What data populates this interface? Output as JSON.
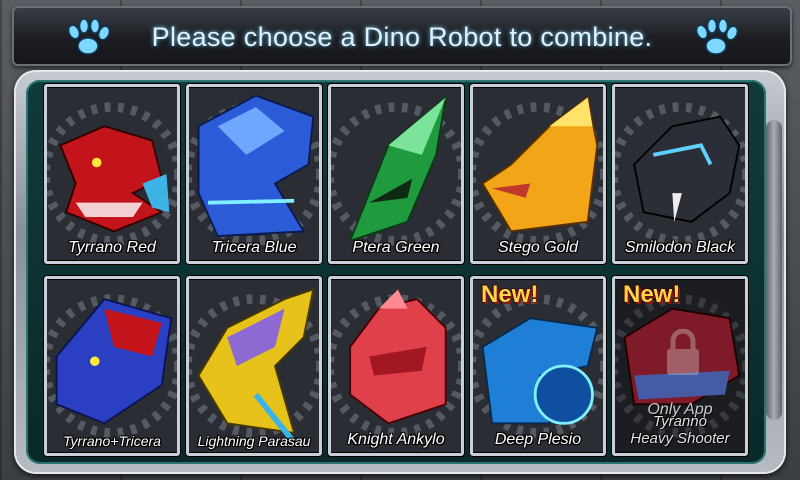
{
  "header": {
    "title": "Please choose a Dino Robot to combine."
  },
  "robots": [
    {
      "name": "Tyrrano Red",
      "color": "#c3141b",
      "accent": "#ff7a7a"
    },
    {
      "name": "Tricera Blue",
      "color": "#2b5bd6",
      "accent": "#9fd0ff"
    },
    {
      "name": "Ptera Green",
      "color": "#1f9a3f",
      "accent": "#8ff0a4"
    },
    {
      "name": "Stego Gold",
      "color": "#f2a516",
      "accent": "#ffe26a"
    },
    {
      "name": "Smilodon Black",
      "color": "#2b2e36",
      "accent": "#5fd0ff"
    },
    {
      "name": "Tyrrano+Tricera",
      "color": "#2a3fc2",
      "accent": "#ff6a6a"
    },
    {
      "name": "Lightning Parasau",
      "color": "#e6c21a",
      "accent": "#8d6ad1"
    },
    {
      "name": "Knight Ankylo",
      "color": "#e0404a",
      "accent": "#ffb0b8"
    },
    {
      "name": "Deep Plesio",
      "color": "#1f7fd6",
      "accent": "#7ff0ff",
      "badge": "New!"
    },
    {
      "name_line1": "Tyranno",
      "name_line2": "Heavy Shooter",
      "color": "#c32840",
      "accent": "#6a8cff",
      "badge": "New!",
      "lock_text": "Only App"
    }
  ]
}
